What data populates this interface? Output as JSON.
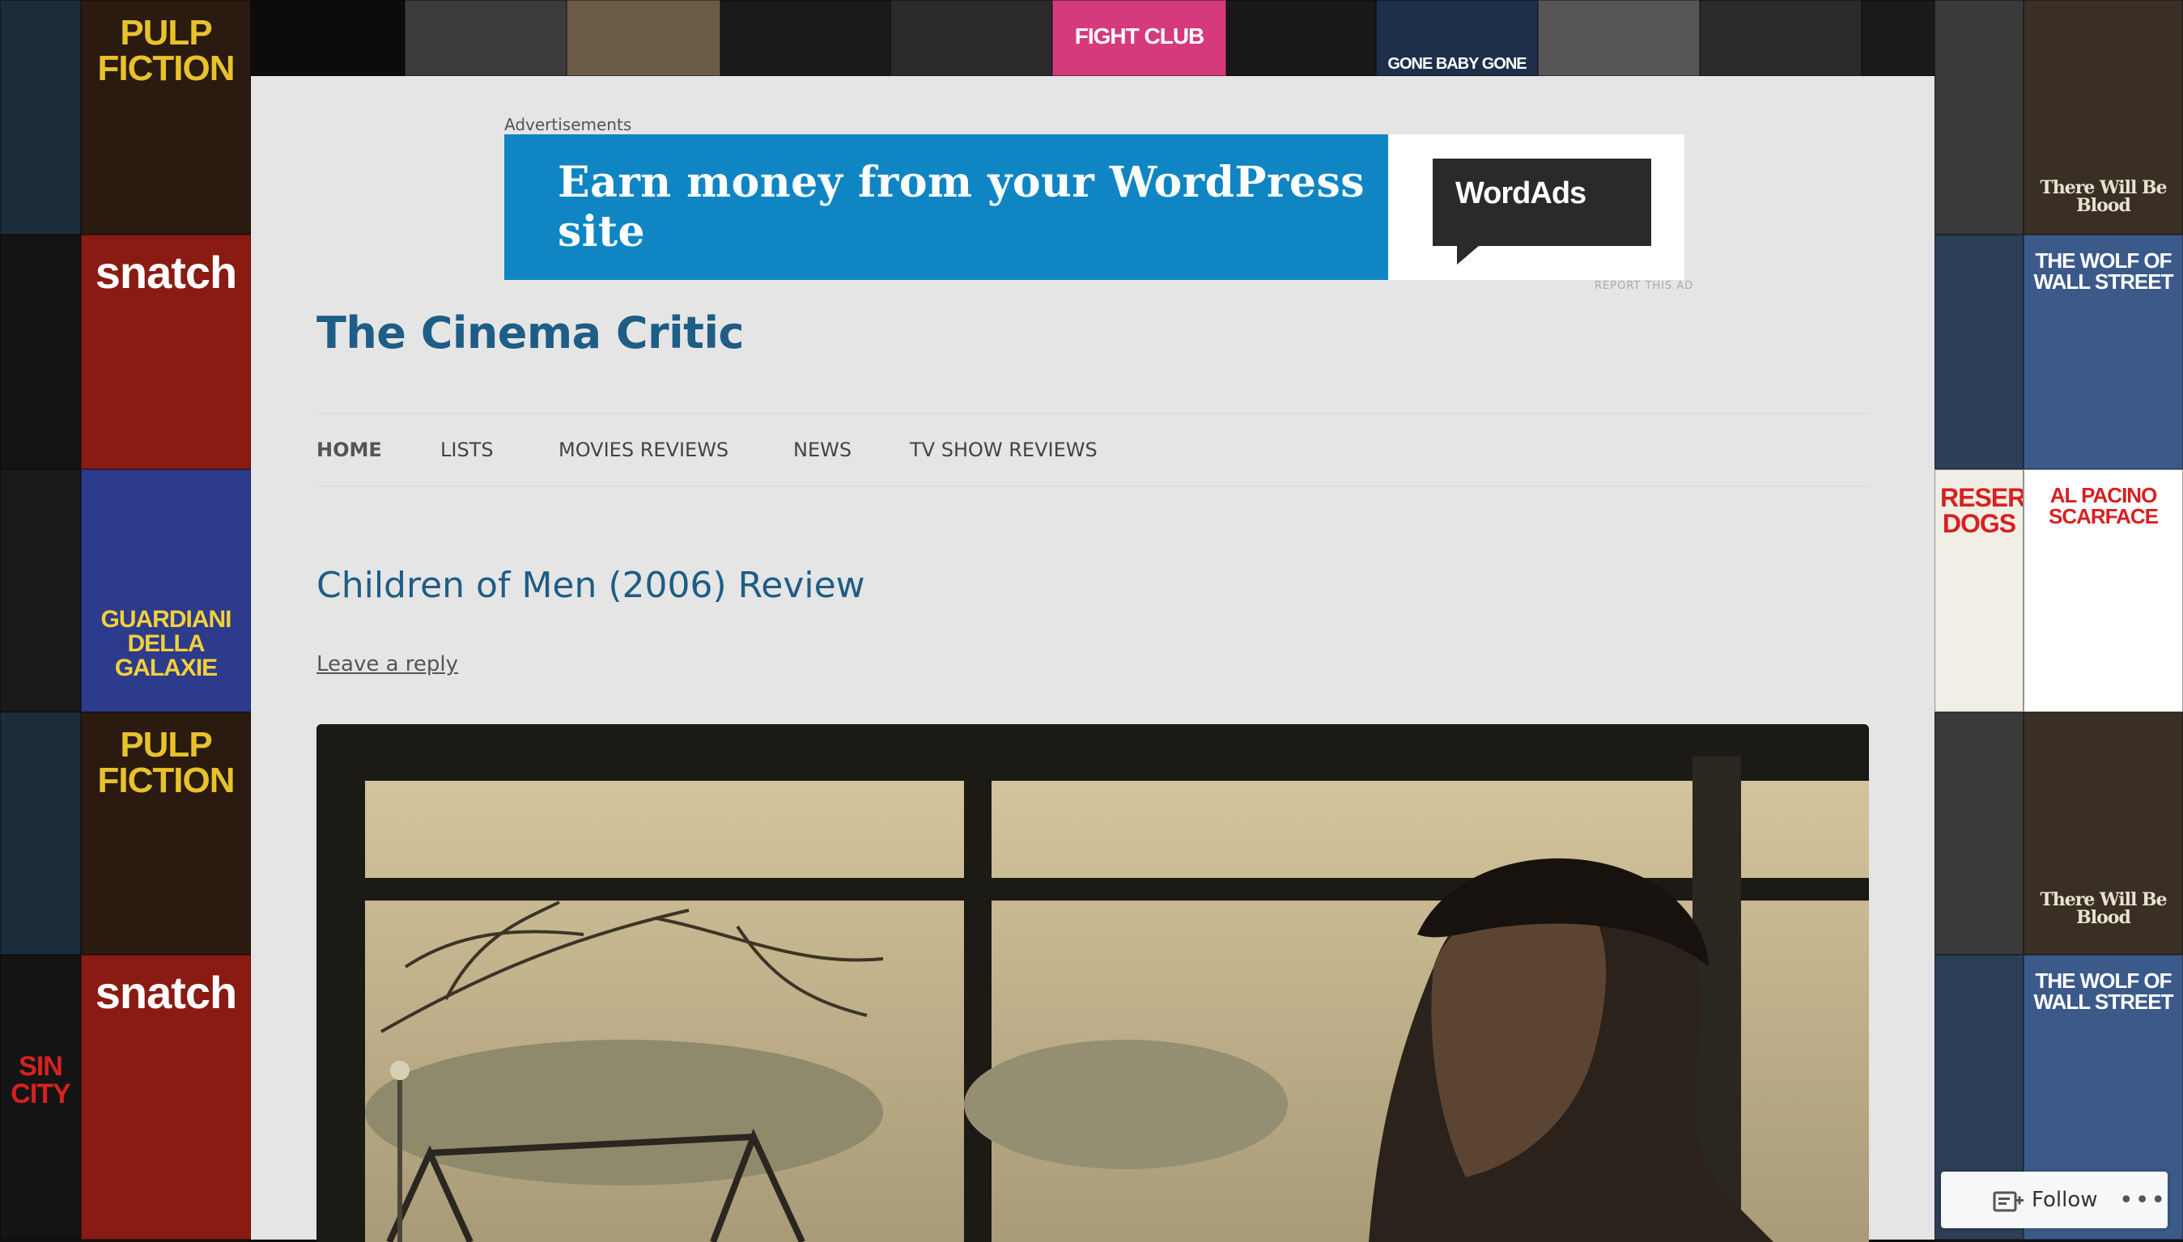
{
  "background": {
    "posters": [
      {
        "label": "PULP FICTION",
        "color": "#e7c22a",
        "bg": "#2a1a10"
      },
      {
        "label": "snatch",
        "color": "#ffffff",
        "bg": "#8a1b12"
      },
      {
        "label": "GUARDIANI DELLA GALAXIE",
        "color": "#f3d03a",
        "bg": "#2c3b8c"
      },
      {
        "label": "GONE BABY GONE",
        "color": "#ffffff",
        "bg": "#1e2f4a"
      },
      {
        "label": "FIGHT CLUB",
        "color": "#ffffff",
        "bg": "#d43a7c"
      },
      {
        "label": "THE WOLF OF WALL STREET",
        "color": "#ffffff",
        "bg": "#3b5a8a"
      },
      {
        "label": "RESERVOIR DOGS",
        "color": "#d82020",
        "bg": "#f1eee6"
      },
      {
        "label": "AL PACINO SCARFACE",
        "color": "#d82020",
        "bg": "#ffffff"
      },
      {
        "label": "There Will Be Blood",
        "color": "#e8e3d0",
        "bg": "#3a2f25"
      },
      {
        "label": "SIN CITY",
        "color": "#d82020",
        "bg": "#121212"
      }
    ]
  },
  "ad": {
    "label": "Advertisements",
    "banner_text": "Earn money from your WordPress site",
    "brand": "WordAds",
    "report": "REPORT THIS AD"
  },
  "site": {
    "title": "The Cinema Critic"
  },
  "nav": {
    "items": [
      "HOME",
      "LISTS",
      "MOVIES REVIEWS",
      "NEWS",
      "TV SHOW REVIEWS"
    ]
  },
  "post": {
    "title": "Children of Men (2006) Review",
    "reply_link": "Leave a reply"
  },
  "follow": {
    "label": "Follow",
    "more": "•••"
  }
}
